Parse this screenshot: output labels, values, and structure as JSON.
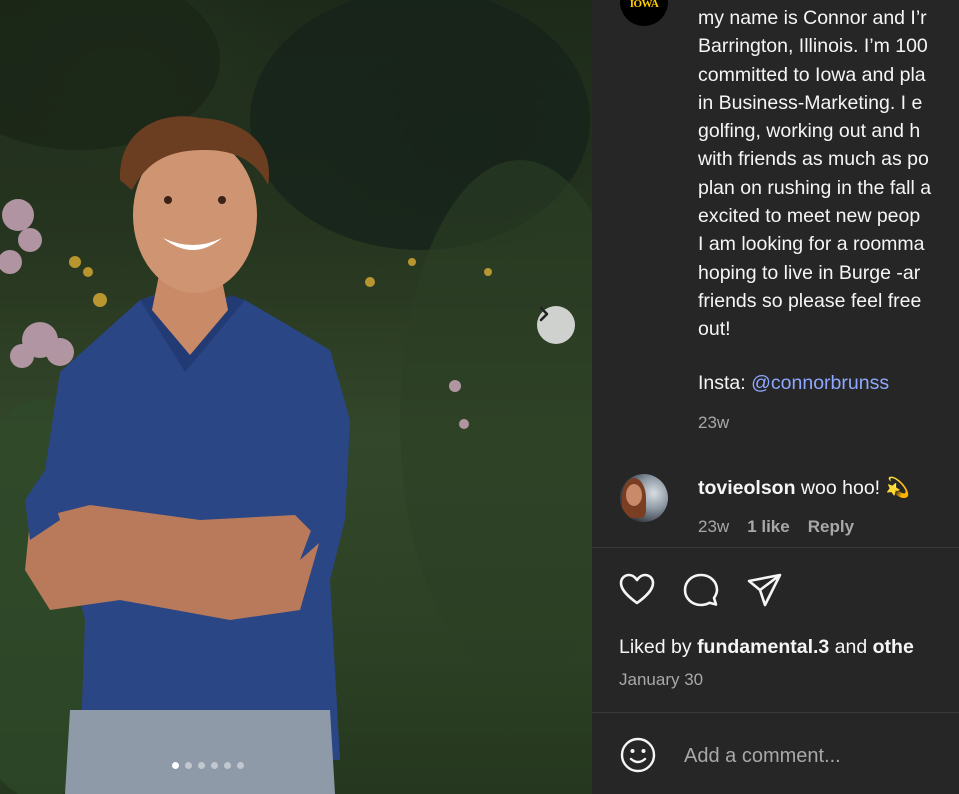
{
  "post": {
    "caption_lines": [
      "my name is Connor and I’r",
      "Barrington, Illinois. I’m 100",
      "committed to Iowa and pla",
      "in Business-Marketing. I e",
      "golfing, working out and h",
      "with friends as much as po",
      "plan on rushing in the fall a",
      "excited to meet new peop",
      "I am looking for a roomma",
      "hoping to live in Burge -ar",
      "friends so please feel free",
      "out!"
    ],
    "insta_label": "Insta: ",
    "insta_handle": "@connorbrunss",
    "caption_time": "23w",
    "author_avatar_text": "IOWA"
  },
  "comment": {
    "username": "tovieolson",
    "text": " woo hoo! 💫",
    "time": "23w",
    "likes": "1 like",
    "reply_label": "Reply"
  },
  "actions": {
    "like_icon": "heart-icon",
    "comment_icon": "comment-icon",
    "share_icon": "send-icon"
  },
  "likes": {
    "prefix": "Liked by ",
    "user": "fundamental.3",
    "middle": " and ",
    "suffix": "othe"
  },
  "date": "January 30",
  "add_comment": {
    "placeholder": "Add a comment..."
  },
  "carousel": {
    "total_images": 6,
    "active_index": 0
  },
  "colors": {
    "panel_bg": "#262626",
    "link": "#8ea8ff",
    "muted": "#a8a8a8"
  }
}
